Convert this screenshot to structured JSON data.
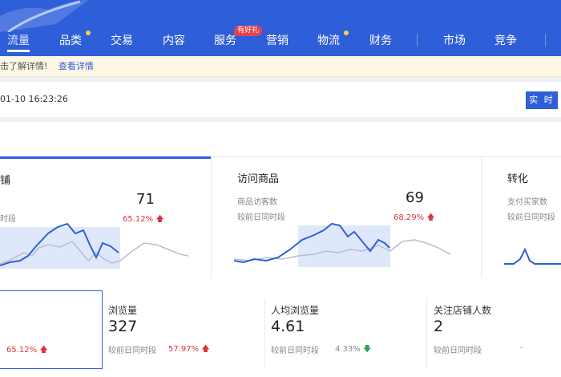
{
  "nav": {
    "items": [
      {
        "label": "流量",
        "active": true
      },
      {
        "label": "品类",
        "dot": true
      },
      {
        "label": "交易"
      },
      {
        "label": "内容"
      },
      {
        "label": "服务",
        "badge": "有好礼"
      },
      {
        "label": "营销"
      },
      {
        "label": "物流",
        "dot": true
      },
      {
        "label": "财务"
      },
      {
        "label": "市场"
      },
      {
        "label": "竞争"
      }
    ]
  },
  "notice": {
    "text": "击了解详情!",
    "link": "查看详情"
  },
  "timebar": {
    "timestamp": "01-10 16:23:26",
    "realtime_button": "实 时"
  },
  "cards": [
    {
      "title": "铺",
      "sub2": "时段",
      "value": "71",
      "pct": "65.12%",
      "trend": "up"
    },
    {
      "title": "访问商品",
      "sub1": "商品访客数",
      "sub2": "较前日同时段",
      "value": "69",
      "pct": "68.29%",
      "trend": "up"
    },
    {
      "title": "转化",
      "sub1": "支付买家数",
      "sub2": "较前日同时段"
    }
  ],
  "metrics": [
    {
      "pct": "65.12%",
      "trend": "up"
    },
    {
      "title": "浏览量",
      "value": "327",
      "compare": "较前日同时段",
      "pct": "57.97%",
      "trend": "up"
    },
    {
      "title": "人均浏览量",
      "value": "4.61",
      "compare": "较前日同时段",
      "pct": "4.33%",
      "trend": "down"
    },
    {
      "title": "关注店铺人数",
      "value": "2",
      "compare": "较前日同时段",
      "pct": "-"
    }
  ],
  "colors": {
    "brand": "#2f5fd8",
    "up": "#d9363e",
    "down": "#27a35a",
    "line_today": "#2f5fd8",
    "line_yesterday": "#b9bec8"
  }
}
